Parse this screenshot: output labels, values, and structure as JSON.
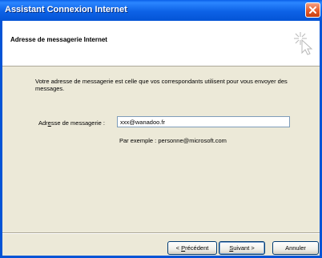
{
  "window": {
    "title": "Assistant Connexion Internet"
  },
  "header": {
    "heading": "Adresse de messagerie Internet"
  },
  "body": {
    "description": "Votre adresse de messagerie est celle que vos correspondants utilisent pour vous envoyer des messages.",
    "email_label_pre": "Adr",
    "email_label_mnemonic": "e",
    "email_label_post": "sse de messagerie :",
    "email_value": "xxx@wanadoo.fr",
    "example": "Par exemple : personne@microsoft.com"
  },
  "buttons": {
    "prev_pre": "< ",
    "prev_mnemonic": "P",
    "prev_post": "récédent",
    "next_mnemonic": "S",
    "next_post": "uivant >",
    "cancel": "Annuler"
  },
  "colors": {
    "titlebar": "#0454d6",
    "dialog_bg": "#ece9d8",
    "close_button": "#e45b2a"
  },
  "icons": {
    "close": "close-icon",
    "wizard": "wizard-cursor-icon"
  }
}
